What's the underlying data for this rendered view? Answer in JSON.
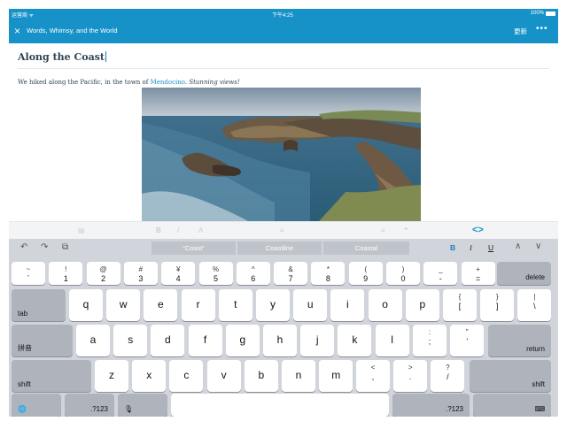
{
  "status_bar": {
    "carrier": "运营商 ᯤ",
    "time": "下午4:25",
    "battery": "100%",
    "battery_level": 1.0
  },
  "nav": {
    "close_icon": "×",
    "site_title": "Words, Whimsy, and the World",
    "update_label": "更新",
    "more_icon": "•••"
  },
  "editor": {
    "post_title": "Along the Coast",
    "body_prefix": "We hiked along the Pacific, in the town of ",
    "body_link": "Mendocino",
    "body_mid": ". ",
    "body_italic": "Stunning views!"
  },
  "format_bar": {
    "html_toggle": "<>"
  },
  "keyboard": {
    "shortcut_bar": {
      "undo": "↶",
      "redo": "↷",
      "paste": "⧉",
      "suggestions": [
        "“Coast”",
        "Coastline",
        "Coastal"
      ],
      "bold": "B",
      "italic": "I",
      "underline": "U",
      "up": "∧",
      "down": "∨"
    },
    "row1": [
      {
        "top": "~",
        "bottom": "`"
      },
      {
        "top": "!",
        "bottom": "1"
      },
      {
        "top": "@",
        "bottom": "2"
      },
      {
        "top": "#",
        "bottom": "3"
      },
      {
        "top": "¥",
        "bottom": "4"
      },
      {
        "top": "%",
        "bottom": "5"
      },
      {
        "top": "^",
        "bottom": "6"
      },
      {
        "top": "&",
        "bottom": "7"
      },
      {
        "top": "*",
        "bottom": "8"
      },
      {
        "top": "(",
        "bottom": "9"
      },
      {
        "top": ")",
        "bottom": "0"
      },
      {
        "top": "_",
        "bottom": "-"
      },
      {
        "top": "+",
        "bottom": "="
      }
    ],
    "delete": "delete",
    "tab": "tab",
    "row2": [
      "q",
      "w",
      "e",
      "r",
      "t",
      "y",
      "u",
      "i",
      "o",
      "p"
    ],
    "row2_sym": [
      {
        "top": "{",
        "bottom": "["
      },
      {
        "top": "}",
        "bottom": "]"
      },
      {
        "top": "|",
        "bottom": "\\"
      }
    ],
    "pinyin": "拼音",
    "row3": [
      "a",
      "s",
      "d",
      "f",
      "g",
      "h",
      "j",
      "k",
      "l"
    ],
    "row3_sym": [
      {
        "top": ":",
        "bottom": ";"
      },
      {
        "top": "\"",
        "bottom": "'"
      }
    ],
    "return": "return",
    "shift": "shift",
    "row4": [
      "z",
      "x",
      "c",
      "v",
      "b",
      "n",
      "m"
    ],
    "row4_sym": [
      {
        "top": "<",
        "bottom": ","
      },
      {
        "top": ">",
        "bottom": "."
      },
      {
        "top": "?",
        "bottom": "/"
      }
    ],
    "globe": "🌐",
    "numbers": ".?123",
    "mic": "🎙",
    "dismiss": "⌨"
  }
}
